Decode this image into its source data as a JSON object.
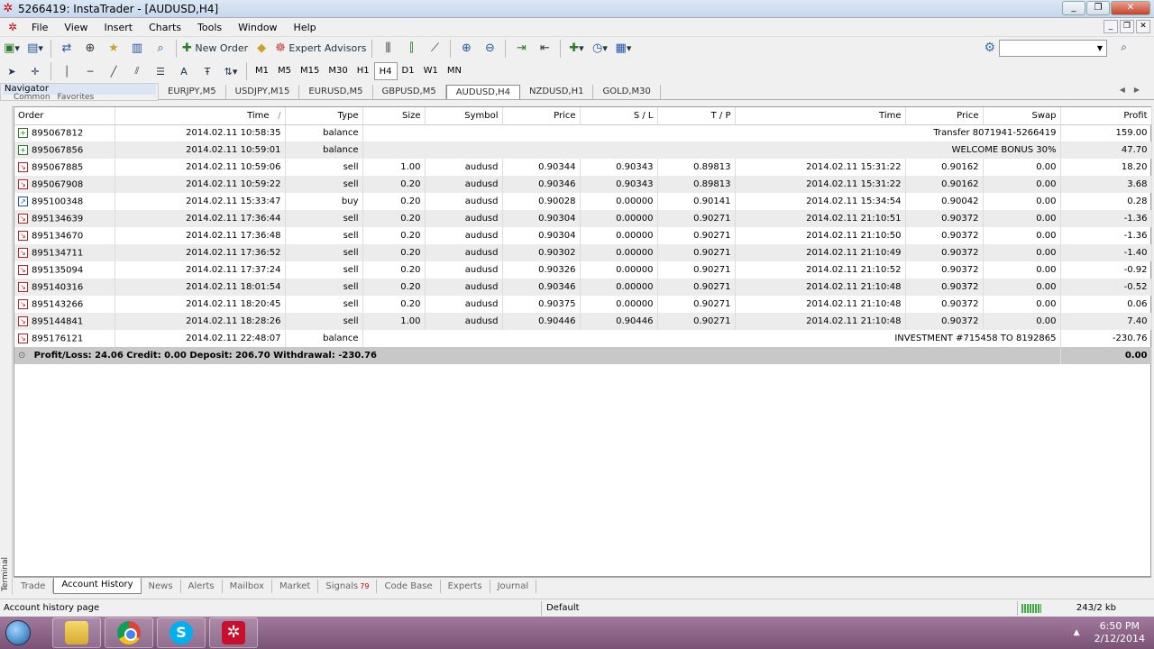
{
  "window": {
    "title": "5266419: InstaTrader - [AUDUSD,H4]"
  },
  "menu": [
    "File",
    "View",
    "Insert",
    "Charts",
    "Tools",
    "Window",
    "Help"
  ],
  "toolbar": {
    "new_order": "New Order",
    "expert_advisors": "Expert Advisors"
  },
  "timeframes": [
    "M1",
    "M5",
    "M15",
    "M30",
    "H1",
    "H4",
    "D1",
    "W1",
    "MN"
  ],
  "active_timeframe": "H4",
  "navigator": {
    "title": "Navigator",
    "tabs": [
      "Common",
      "Favorites"
    ]
  },
  "chart_tabs": [
    "EURJPY,M5",
    "USDJPY,M15",
    "EURUSD,M5",
    "GBPUSD,M5",
    "AUDUSD,H4",
    "NZDUSD,H1",
    "GOLD,M30"
  ],
  "active_chart_tab": "AUDUSD,H4",
  "terminal_label": "Terminal",
  "columns": {
    "order": "Order",
    "open_time": "Time",
    "sort_mark": "/",
    "type": "Type",
    "size": "Size",
    "symbol": "Symbol",
    "price": "Price",
    "sl": "S / L",
    "tp": "T / P",
    "close_time": "Time",
    "close_price": "Price",
    "swap": "Swap",
    "profit": "Profit"
  },
  "rows": [
    {
      "order": "895067812",
      "open_time": "2014.02.11 10:58:35",
      "type": "balance",
      "comment": "Transfer 8071941-5266419",
      "profit": "159.00",
      "icon": "green"
    },
    {
      "order": "895067856",
      "open_time": "2014.02.11 10:59:01",
      "type": "balance",
      "comment": "WELCOME BONUS 30%",
      "profit": "47.70",
      "icon": "green"
    },
    {
      "order": "895067885",
      "open_time": "2014.02.11 10:59:06",
      "type": "sell",
      "size": "1.00",
      "symbol": "audusd",
      "price": "0.90344",
      "sl": "0.90343",
      "tp": "0.89813",
      "close_time": "2014.02.11 15:31:22",
      "close_price": "0.90162",
      "swap": "0.00",
      "profit": "18.20",
      "icon": "red"
    },
    {
      "order": "895067908",
      "open_time": "2014.02.11 10:59:22",
      "type": "sell",
      "size": "0.20",
      "symbol": "audusd",
      "price": "0.90346",
      "sl": "0.90343",
      "tp": "0.89813",
      "close_time": "2014.02.11 15:31:22",
      "close_price": "0.90162",
      "swap": "0.00",
      "profit": "3.68",
      "icon": "red"
    },
    {
      "order": "895100348",
      "open_time": "2014.02.11 15:33:47",
      "type": "buy",
      "size": "0.20",
      "symbol": "audusd",
      "price": "0.90028",
      "sl": "0.00000",
      "tp": "0.90141",
      "close_time": "2014.02.11 15:34:54",
      "close_price": "0.90042",
      "swap": "0.00",
      "profit": "0.28",
      "icon": "blue"
    },
    {
      "order": "895134639",
      "open_time": "2014.02.11 17:36:44",
      "type": "sell",
      "size": "0.20",
      "symbol": "audusd",
      "price": "0.90304",
      "sl": "0.00000",
      "tp": "0.90271",
      "close_time": "2014.02.11 21:10:51",
      "close_price": "0.90372",
      "swap": "0.00",
      "profit": "-1.36",
      "icon": "red"
    },
    {
      "order": "895134670",
      "open_time": "2014.02.11 17:36:48",
      "type": "sell",
      "size": "0.20",
      "symbol": "audusd",
      "price": "0.90304",
      "sl": "0.00000",
      "tp": "0.90271",
      "close_time": "2014.02.11 21:10:50",
      "close_price": "0.90372",
      "swap": "0.00",
      "profit": "-1.36",
      "icon": "red"
    },
    {
      "order": "895134711",
      "open_time": "2014.02.11 17:36:52",
      "type": "sell",
      "size": "0.20",
      "symbol": "audusd",
      "price": "0.90302",
      "sl": "0.00000",
      "tp": "0.90271",
      "close_time": "2014.02.11 21:10:49",
      "close_price": "0.90372",
      "swap": "0.00",
      "profit": "-1.40",
      "icon": "red"
    },
    {
      "order": "895135094",
      "open_time": "2014.02.11 17:37:24",
      "type": "sell",
      "size": "0.20",
      "symbol": "audusd",
      "price": "0.90326",
      "sl": "0.00000",
      "tp": "0.90271",
      "close_time": "2014.02.11 21:10:52",
      "close_price": "0.90372",
      "swap": "0.00",
      "profit": "-0.92",
      "icon": "red"
    },
    {
      "order": "895140316",
      "open_time": "2014.02.11 18:01:54",
      "type": "sell",
      "size": "0.20",
      "symbol": "audusd",
      "price": "0.90346",
      "sl": "0.00000",
      "tp": "0.90271",
      "close_time": "2014.02.11 21:10:48",
      "close_price": "0.90372",
      "swap": "0.00",
      "profit": "-0.52",
      "icon": "red"
    },
    {
      "order": "895143266",
      "open_time": "2014.02.11 18:20:45",
      "type": "sell",
      "size": "0.20",
      "symbol": "audusd",
      "price": "0.90375",
      "sl": "0.00000",
      "tp": "0.90271",
      "close_time": "2014.02.11 21:10:48",
      "close_price": "0.90372",
      "swap": "0.00",
      "profit": "0.06",
      "icon": "red"
    },
    {
      "order": "895144841",
      "open_time": "2014.02.11 18:28:26",
      "type": "sell",
      "size": "1.00",
      "symbol": "audusd",
      "price": "0.90446",
      "sl": "0.90446",
      "tp": "0.90271",
      "close_time": "2014.02.11 21:10:48",
      "close_price": "0.90372",
      "swap": "0.00",
      "profit": "7.40",
      "icon": "red"
    },
    {
      "order": "895176121",
      "open_time": "2014.02.11 22:48:07",
      "type": "balance",
      "comment": "INVESTMENT #715458 TO 8192865",
      "profit": "-230.76",
      "icon": "red"
    }
  ],
  "summary": {
    "text": "Profit/Loss: 24.06  Credit: 0.00  Deposit: 206.70  Withdrawal: -230.76",
    "profit": "0.00"
  },
  "bottom_tabs": [
    "Trade",
    "Account History",
    "News",
    "Alerts",
    "Mailbox",
    "Market",
    "Signals",
    "Code Base",
    "Experts",
    "Journal"
  ],
  "active_bottom_tab": "Account History",
  "signals_badge": "79",
  "status": {
    "left": "Account history page",
    "profile": "Default",
    "traffic": "243/2 kb"
  },
  "taskbar": {
    "time": "6:50 PM",
    "date": "2/12/2014"
  }
}
